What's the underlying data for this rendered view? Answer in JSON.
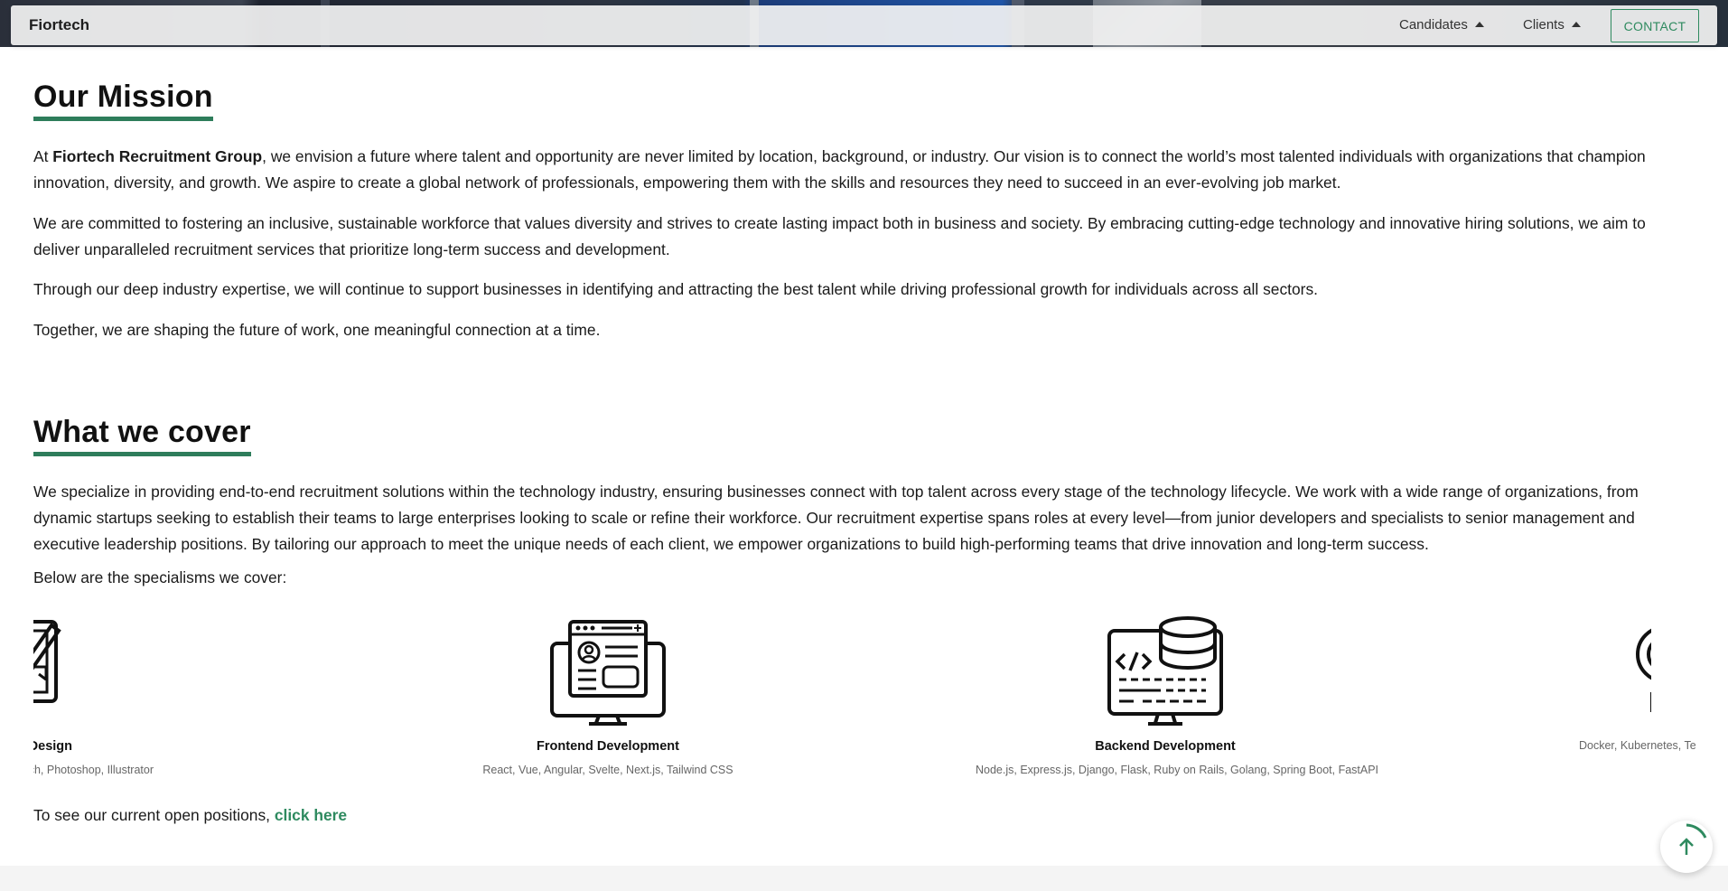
{
  "navbar": {
    "brand": "Fiortech",
    "items": [
      {
        "label": "Candidates"
      },
      {
        "label": "Clients"
      }
    ],
    "contact_label": "CONTACT"
  },
  "mission": {
    "title": "Our Mission",
    "p1_lead": "At ",
    "p1_bold": "Fiortech Recruitment Group",
    "p1_rest": ", we envision a future where talent and opportunity are never limited by location, background, or industry. Our vision is to connect the world’s most talented individuals with organizations that champion innovation, diversity, and growth. We aspire to create a global network of professionals, empowering them with the skills and resources they need to succeed in an ever-evolving job market.",
    "p2": "We are committed to fostering an inclusive, sustainable workforce that values diversity and strives to create lasting impact both in business and society. By embracing cutting-edge technology and innovative hiring solutions, we aim to deliver unparalleled recruitment services that prioritize long-term success and development.",
    "p3": "Through our deep industry expertise, we will continue to support businesses in identifying and attracting the best talent while driving professional growth for individuals across all sectors.",
    "p4": "Together, we are shaping the future of work, one meaningful connection at a time."
  },
  "cover": {
    "title": "What we cover",
    "p1": "We specialize in providing end-to-end recruitment solutions within the technology industry, ensuring businesses connect with top talent across every stage of the technology lifecycle. We work with a wide range of organizations, from dynamic startups seeking to establish their teams to large enterprises looking to scale or refine their workforce. Our recruitment expertise spans roles at every level—from junior developers and specialists to senior management and executive leadership positions. By tailoring our approach to meet the unique needs of each client, we empower organizations to build high-performing teams that drive innovation and long-term success.",
    "p2": "Below are the specialisms we cover:",
    "specialisms": [
      {
        "title": "Design",
        "subtitle": "etch, Photoshop, Illustrator",
        "icon": "design-monitor-icon"
      },
      {
        "title": "Frontend Development",
        "subtitle": "React, Vue, Angular, Svelte, Next.js, Tailwind CSS",
        "icon": "frontend-monitor-icon"
      },
      {
        "title": "Backend Development",
        "subtitle": "Node.js, Express.js, Django, Flask, Ruby on Rails, Golang, Spring Boot, FastAPI",
        "icon": "backend-monitor-icon"
      },
      {
        "title": "",
        "subtitle": "Docker, Kubernetes, Terrafor",
        "icon": "devops-gear-icon"
      }
    ]
  },
  "cta": {
    "text": "To see our current open positions, ",
    "link": "click here"
  },
  "colors": {
    "accent": "#2e8a5f",
    "underline": "#2e7d5b"
  },
  "scroll_top_icon": "arrow-up-icon"
}
